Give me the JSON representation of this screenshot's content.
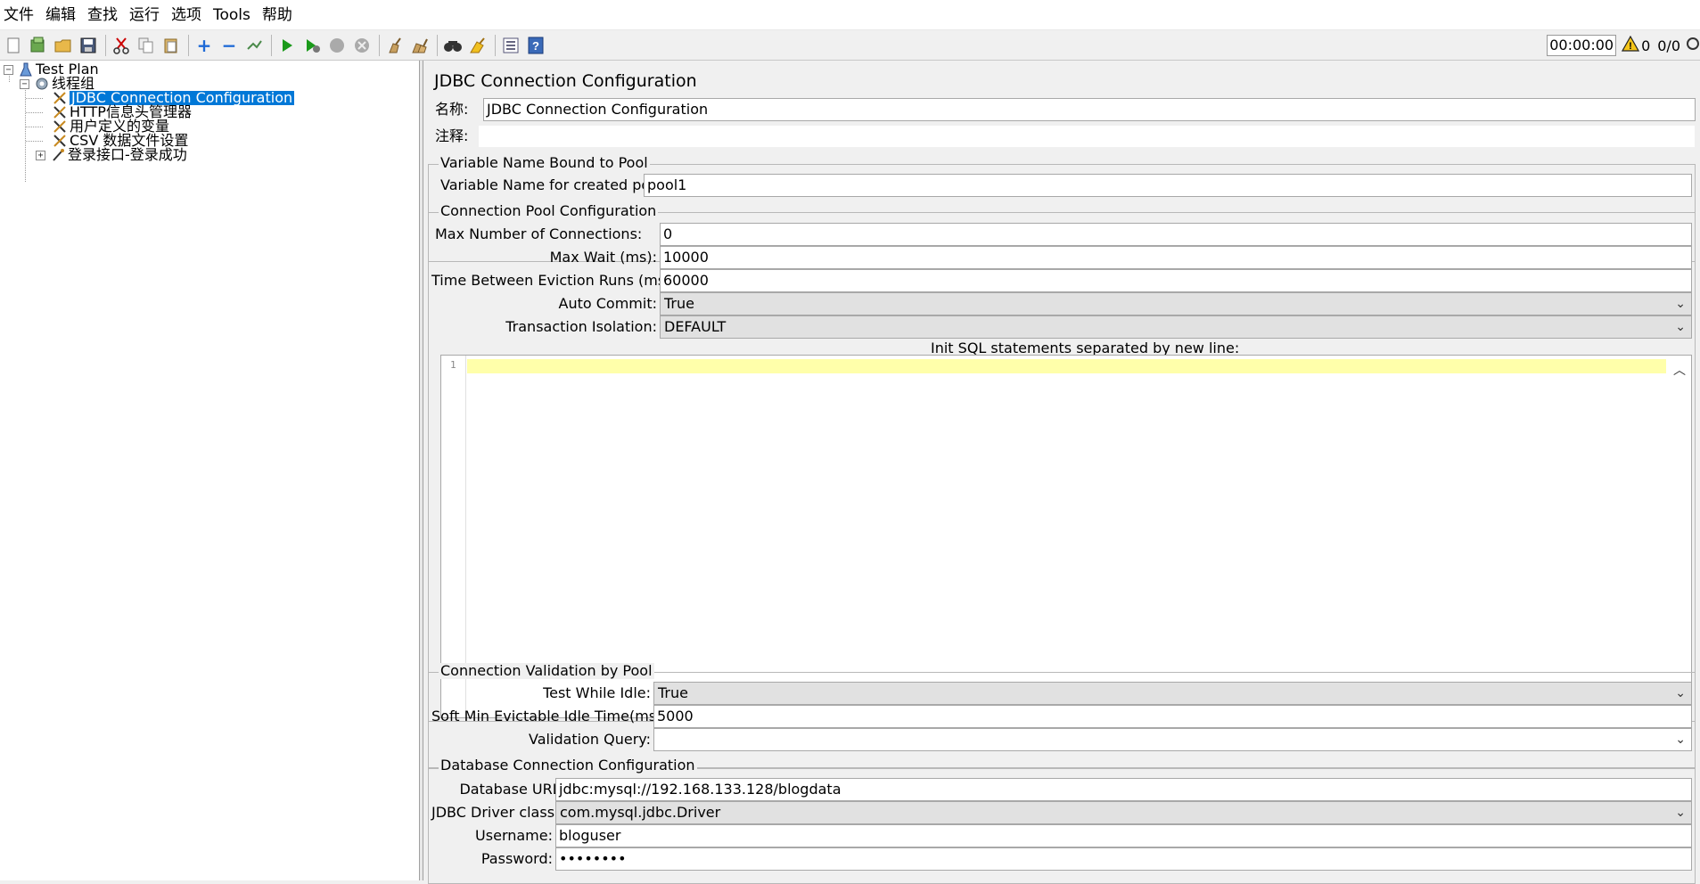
{
  "menu": [
    "文件",
    "编辑",
    "查找",
    "运行",
    "选项",
    "Tools",
    "帮助"
  ],
  "toolbar": {
    "timer": "00:00:00",
    "warn_count": "0",
    "ratio": "0/0"
  },
  "tree": {
    "root": "Test Plan",
    "thread_group": "线程组",
    "items": [
      "JDBC Connection Configuration",
      "HTTP信息头管理器",
      "用户定义的变量",
      "CSV 数据文件设置",
      "登录接口-登录成功"
    ]
  },
  "panel": {
    "title": "JDBC Connection Configuration",
    "name_label": "名称:",
    "name_value": "JDBC Connection Configuration",
    "comment_label": "注释:",
    "comment_value": ""
  },
  "var_group": {
    "title": "Variable Name Bound to Pool",
    "var_label": "Variable Name for created pool:",
    "var_value": "pool1"
  },
  "pool_group": {
    "title": "Connection Pool Configuration",
    "max_conn_label": "Max Number of Connections:",
    "max_conn_value": "0",
    "max_wait_label": "Max Wait (ms):",
    "max_wait_value": "10000",
    "eviction_label": "Time Between Eviction Runs (ms):",
    "eviction_value": "60000",
    "auto_commit_label": "Auto Commit:",
    "auto_commit_value": "True",
    "isolation_label": "Transaction Isolation:",
    "isolation_value": "DEFAULT",
    "init_sql_label": "Init SQL statements separated by new line:",
    "line_number": "1"
  },
  "validation_group": {
    "title": "Connection Validation by Pool",
    "test_idle_label": "Test While Idle:",
    "test_idle_value": "True",
    "soft_min_label": "Soft Min Evictable Idle Time(ms):",
    "soft_min_value": "5000",
    "query_label": "Validation Query:",
    "query_value": ""
  },
  "db_group": {
    "title": "Database Connection Configuration",
    "url_label": "Database URL:",
    "url_value": "jdbc:mysql://192.168.133.128/blogdata",
    "driver_label": "JDBC Driver class:",
    "driver_value": "com.mysql.jdbc.Driver",
    "user_label": "Username:",
    "user_value": "bloguser",
    "password_label": "Password:",
    "password_value": "••••••••"
  },
  "icons": {
    "new": "new-icon",
    "templates": "templates-icon",
    "open": "open-icon",
    "save": "save-icon",
    "cut": "cut-icon",
    "copy": "copy-icon",
    "paste": "paste-icon",
    "expand": "expand-icon",
    "collapse": "collapse-icon",
    "toggle": "toggle-icon",
    "start": "start-icon",
    "start_no_pause": "start-no-pause-icon",
    "stop": "stop-icon",
    "shutdown": "shutdown-icon",
    "clear": "clear-icon",
    "clear_all": "clear-all-icon",
    "search": "search-icon",
    "reset_search": "reset-search-icon",
    "function_helper": "function-helper-icon",
    "help": "help-icon",
    "warning": "warning-icon"
  },
  "colors": {
    "selection": "#0078d7",
    "current_line": "#ffffaa"
  }
}
